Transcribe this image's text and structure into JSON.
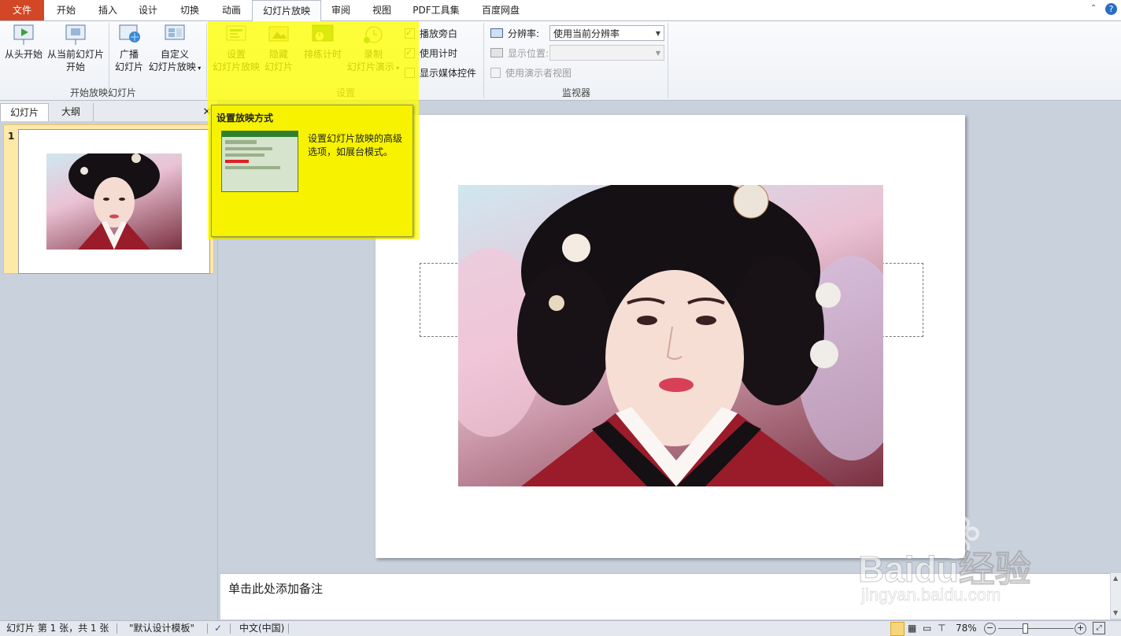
{
  "tabs": [
    {
      "label": "文件",
      "type": "file"
    },
    {
      "label": "开始"
    },
    {
      "label": "插入"
    },
    {
      "label": "设计"
    },
    {
      "label": "切换"
    },
    {
      "label": "动画"
    },
    {
      "label": "幻灯片放映",
      "active": true
    },
    {
      "label": "审阅"
    },
    {
      "label": "视图"
    },
    {
      "label": "PDF工具集"
    },
    {
      "label": "百度网盘"
    }
  ],
  "ribbon": {
    "start_group": {
      "label": "开始放映幻灯片",
      "from_beginning": "从头开始",
      "from_current_1": "从当前幻灯片",
      "from_current_2": "开始",
      "broadcast_1": "广播",
      "broadcast_2": "幻灯片",
      "custom_1": "自定义",
      "custom_2": "幻灯片放映"
    },
    "setup_group": {
      "label": "设置",
      "setup_1": "设置",
      "setup_2": "幻灯片放映",
      "hide_1": "隐藏",
      "hide_2": "幻灯片",
      "rehearse": "排练计时",
      "record_1": "录制",
      "record_2": "幻灯片演示",
      "play_narration": "播放旁白",
      "use_timings": "使用计时",
      "show_media": "显示媒体控件"
    },
    "monitor_group": {
      "label": "监视器",
      "resolution_label": "分辨率:",
      "resolution_value": "使用当前分辨率",
      "display_label": "显示位置:",
      "presenter_view": "使用演示者视图"
    }
  },
  "tooltip": {
    "title": "设置放映方式",
    "body_1": "设置幻灯片放映的高级",
    "body_2": "选项，如展台模式。"
  },
  "left_pane": {
    "tab_slides": "幻灯片",
    "tab_outline": "大纲",
    "close": "✕",
    "slide_number": "1"
  },
  "notes": {
    "placeholder": "单击此处添加备注"
  },
  "status": {
    "slide_info": "幻灯片 第 1 张，共 1 张",
    "theme": "\"默认设计模板\"",
    "language": "中文(中国)",
    "zoom": "78%"
  },
  "watermark": {
    "brand": "Baidu经验",
    "url": "jingyan.baidu.com"
  },
  "colors": {
    "file_tab": "#d24726",
    "highlight": "#ffff00",
    "accent": "#2b5797"
  }
}
